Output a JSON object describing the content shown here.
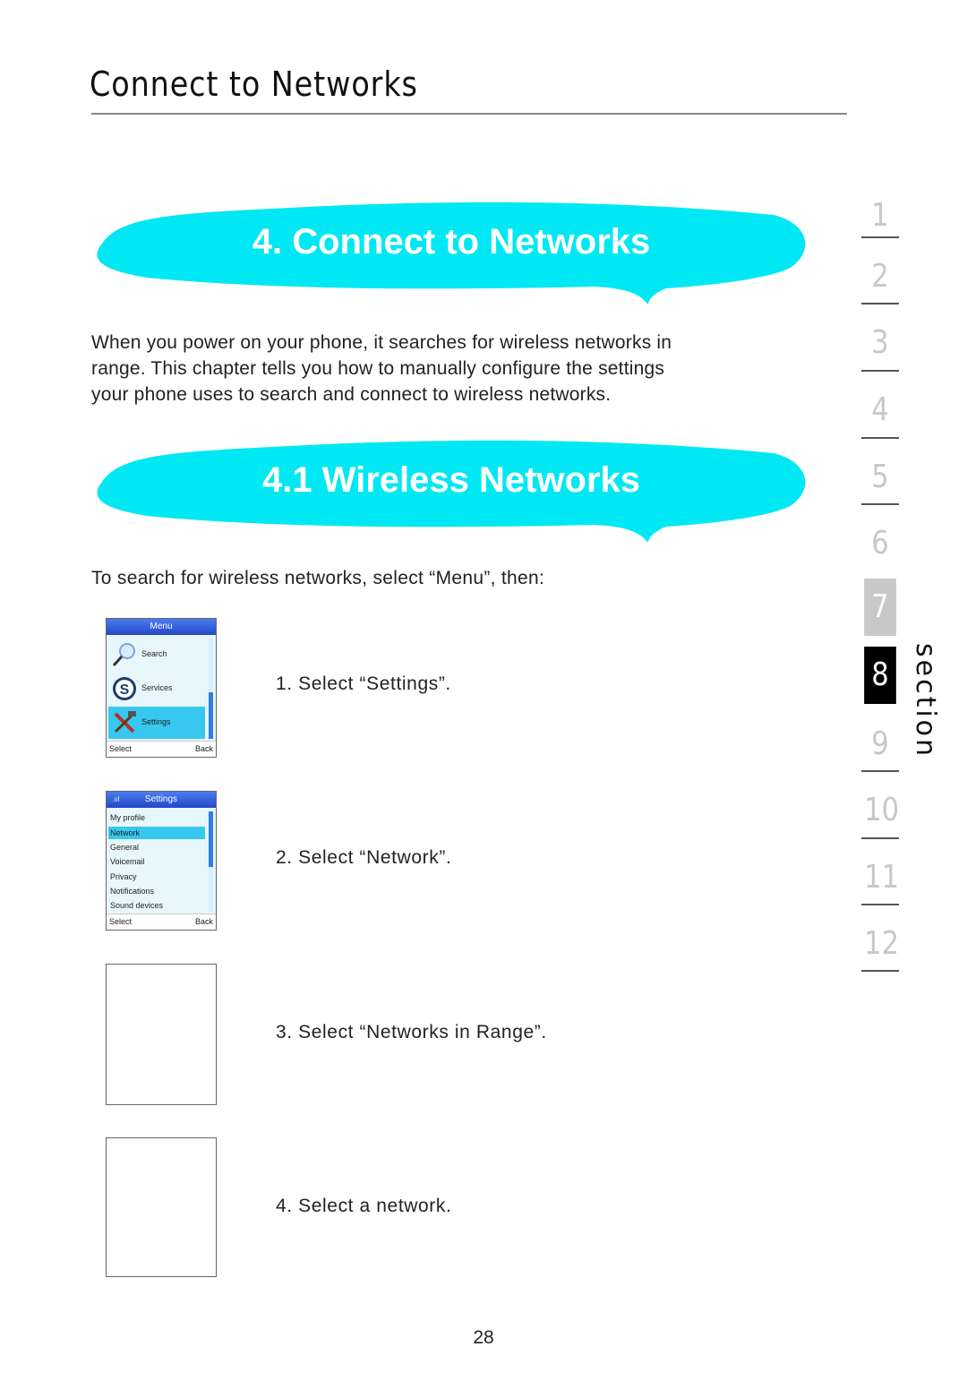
{
  "header": {
    "title": "Connect to Networks"
  },
  "sections": [
    {
      "heading": "4. Connect to Networks",
      "bubble_color": "#00e8f3"
    },
    {
      "heading": "4.1 Wireless Networks",
      "bubble_color": "#00e8f3"
    }
  ],
  "intro_paragraph": [
    "When you power on your phone, it searches for wireless networks in",
    "range. This chapter tells you how to manually configure the settings",
    "your phone uses to search and connect to wireless networks."
  ],
  "instruction": "To search for wireless networks, select “Menu”, then:",
  "steps": [
    {
      "text": "1. Select “Settings”."
    },
    {
      "text": "2. Select “Network”."
    },
    {
      "text": "3. Select “Networks in Range”."
    },
    {
      "text": "4. Select a network."
    }
  ],
  "screens": {
    "menu": {
      "title": "Menu",
      "items": [
        {
          "label": "Search",
          "icon": "magnifier-icon"
        },
        {
          "label": "Services",
          "icon": "skype-icon"
        },
        {
          "label": "Settings",
          "icon": "tools-icon",
          "selected": true
        }
      ],
      "softkey_left": "Select",
      "softkey_right": "Back"
    },
    "settings": {
      "title": "Settings",
      "signal": ".ııl",
      "items": [
        {
          "label": "My profile"
        },
        {
          "label": "Network",
          "selected": true
        },
        {
          "label": "General"
        },
        {
          "label": "Voicemail"
        },
        {
          "label": "Privacy"
        },
        {
          "label": "Notifications"
        },
        {
          "label": "Sound devices"
        }
      ],
      "softkey_left": "Select",
      "softkey_right": "Back"
    }
  },
  "section_nav": {
    "label": "section",
    "numbers": [
      "1",
      "2",
      "3",
      "4",
      "5",
      "6",
      "7",
      "8",
      "9",
      "10",
      "11",
      "12"
    ],
    "active": "8",
    "colors": {
      "inactive": "#c8c8c8",
      "active_bg": "#000000",
      "prev_bg": "#c8c8c8"
    }
  },
  "page_number": "28"
}
